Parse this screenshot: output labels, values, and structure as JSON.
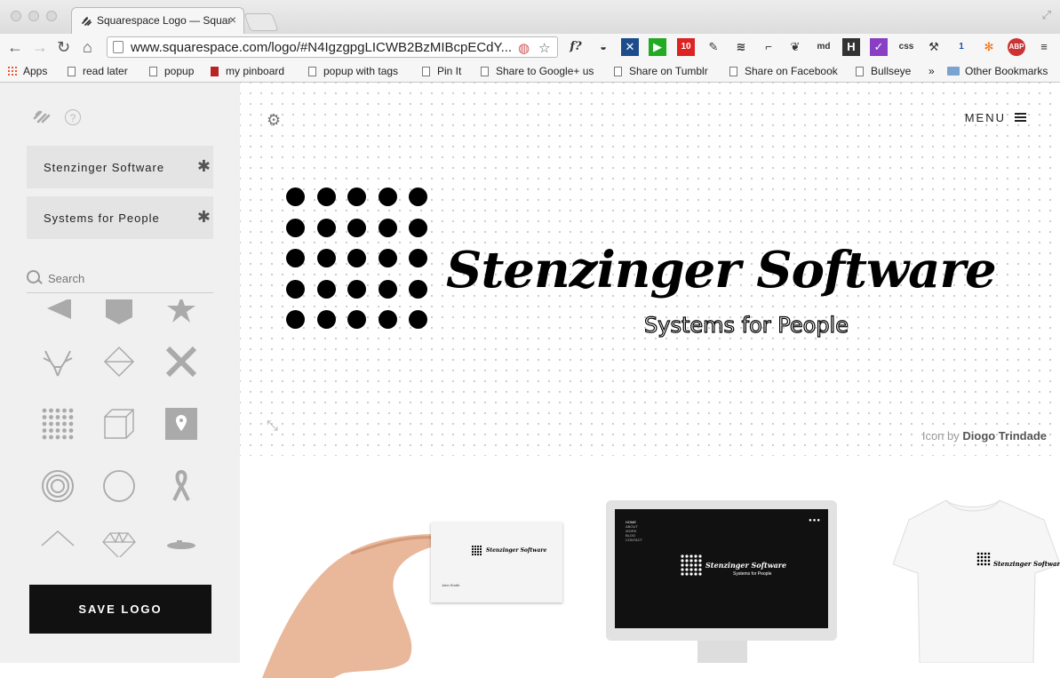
{
  "browser": {
    "tab_title": "Squarespace Logo — Squarespace",
    "url": "www.squarespace.com/logo/#N4IgzgpgLICWB2BzMIBcpECdY...",
    "extensions": [
      "f?",
      "10",
      "md",
      "H",
      "css",
      "1",
      "ABP"
    ],
    "bookmarks": [
      "Apps",
      "read later",
      "popup",
      "my pinboard",
      "popup with tags",
      "Pin It",
      "Share to Google+ us",
      "Share on Tumblr",
      "Share on Facebook",
      "Bullseye",
      "»",
      "Other Bookmarks"
    ]
  },
  "sidebar": {
    "field1": "Stenzinger Software",
    "field2": "Systems for People",
    "search_placeholder": "Search",
    "save_label": "SAVE LOGO"
  },
  "main": {
    "menu_label": "MENU",
    "brand_name": "Stenzinger Software",
    "tagline": "Systems for People",
    "credit_prefix": "Icon by",
    "credit_author": "Diogo Trindade"
  },
  "mockups": {
    "card_name": "Stenzinger Software",
    "screen_brand": "Stenzinger Software",
    "screen_tagline": "Systems for People",
    "screen_nav": [
      "HOME",
      "ABOUT",
      "WORK",
      "BLOG",
      "CONTACT"
    ],
    "card_person": "John Smith",
    "shirt_brand": "Stenzinger Software"
  }
}
